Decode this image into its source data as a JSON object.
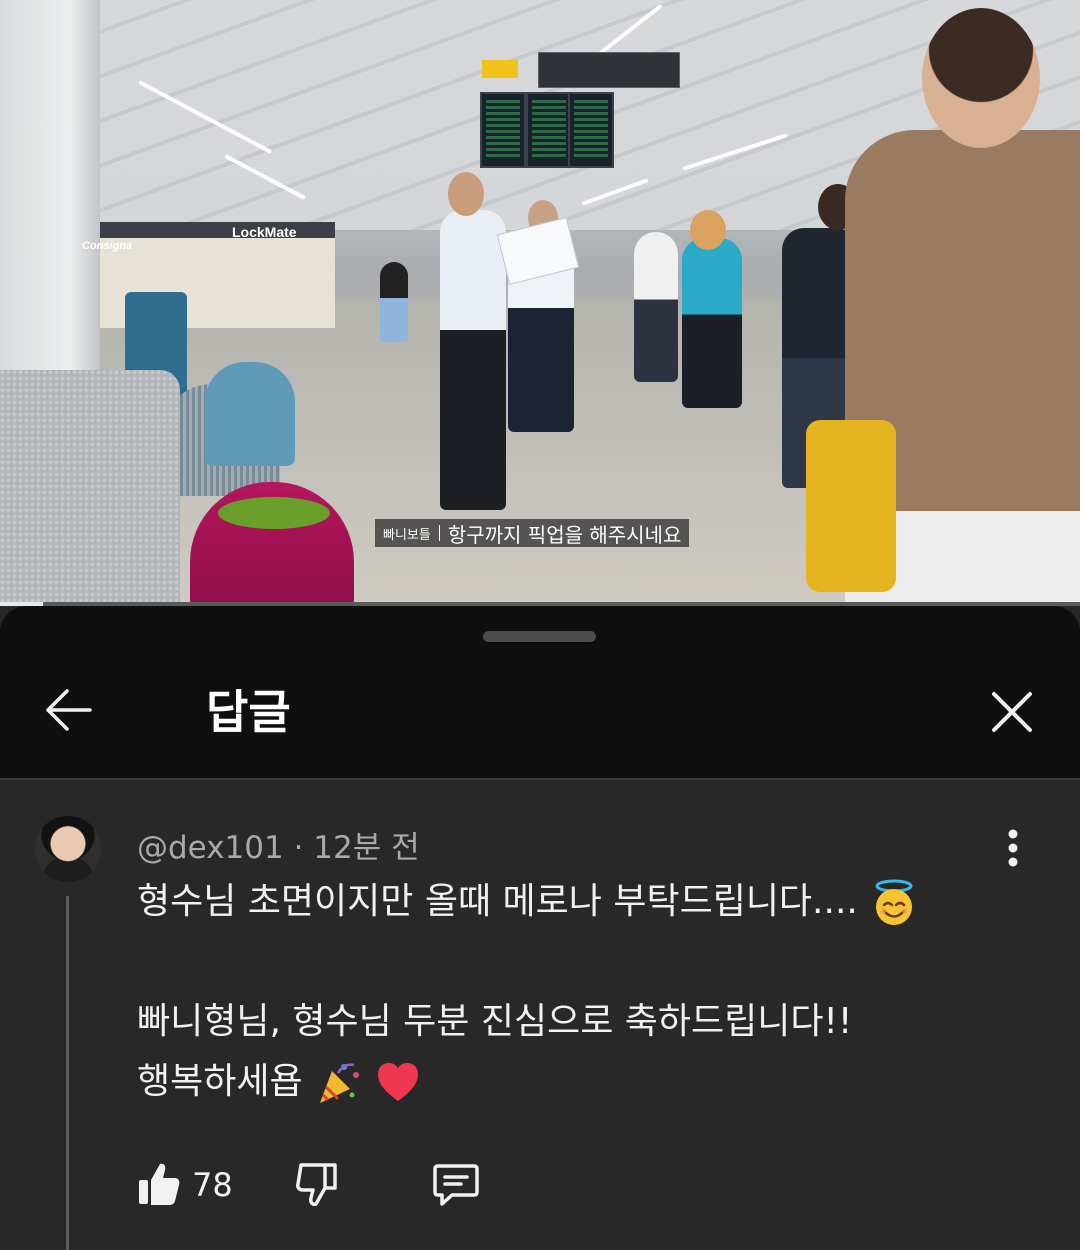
{
  "video": {
    "subtitle_channel": "빠니보틀",
    "subtitle_text": "항구까지 픽업을 해주시네요",
    "store_sign": "LockMate",
    "consigna_sign": "Consigna",
    "progress_fraction": 0.04
  },
  "sheet": {
    "title": "답글"
  },
  "comment": {
    "meta": "@dex101 · 12분 전",
    "line1": "형수님 초면이지만 올때 메로나 부탁드립니다....",
    "line2": "빠니형님, 형수님 두분 진심으로 축하드립니다!!",
    "line3": "행복하세욥",
    "like_count": "78"
  },
  "colors": {
    "sheet_bg": "#282828",
    "header_bg": "#0f0f0f",
    "text_primary": "#f1f1f1",
    "text_secondary": "#a9a9a9"
  },
  "icons": {
    "back": "arrow-left-icon",
    "close": "close-icon",
    "more": "more-vert-icon",
    "like": "thumb-up-icon",
    "dislike": "thumb-down-icon",
    "reply": "comment-icon"
  }
}
